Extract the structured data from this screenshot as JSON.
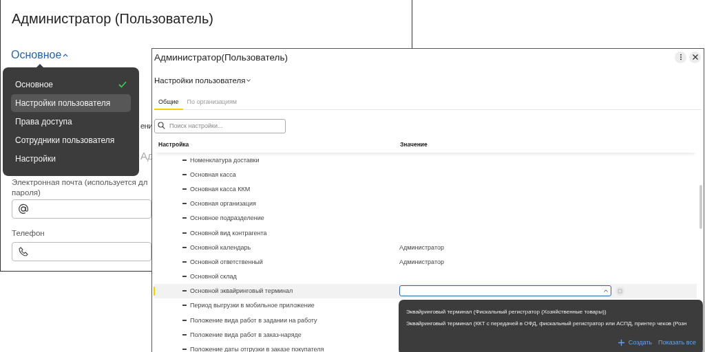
{
  "back_window": {
    "title": "Администратор (Пользователь)",
    "section_toggle": {
      "label": "Основное",
      "expanded": true
    },
    "section_menu": [
      {
        "label": "Основное",
        "selected": true,
        "hovered": false
      },
      {
        "label": "Настройки пользователя",
        "selected": false,
        "hovered": true
      },
      {
        "label": "Права доступа",
        "selected": false,
        "hovered": false
      },
      {
        "label": "Сотрудники пользователя",
        "selected": false,
        "hovered": false
      },
      {
        "label": "Настройки",
        "selected": false,
        "hovered": false
      }
    ],
    "obscured_texts": [
      "ени",
      "Ад"
    ],
    "fields": [
      {
        "kind": "email",
        "label": "Электронная почта (используется дл\nпароля)"
      },
      {
        "kind": "phone",
        "label": "Телефон"
      }
    ]
  },
  "front_window": {
    "title": "Администратор(Пользователь)",
    "section_label": "Настройки пользователя",
    "tabs": [
      {
        "label": "Общие",
        "selected": true
      },
      {
        "label": "По организациям",
        "selected": false
      }
    ],
    "search": {
      "placeholder": "Поиск настройки..."
    },
    "table": {
      "columns": [
        "Настройка",
        "Значение"
      ],
      "rows": [
        {
          "name": "Номенклатура доставки",
          "value": "",
          "selected": false
        },
        {
          "name": "Основная касса",
          "value": "",
          "selected": false
        },
        {
          "name": "Основная касса ККМ",
          "value": "",
          "selected": false
        },
        {
          "name": "Основная организация",
          "value": "",
          "selected": false
        },
        {
          "name": "Основное подразделение",
          "value": "",
          "selected": false
        },
        {
          "name": "Основной вид контрагента",
          "value": "",
          "selected": false
        },
        {
          "name": "Основной календарь",
          "value": "Администратор",
          "selected": false
        },
        {
          "name": "Основной ответственный",
          "value": "Администратор",
          "selected": false
        },
        {
          "name": "Основной склад",
          "value": "",
          "selected": false
        },
        {
          "name": "Основной эквайринговый терминал",
          "value": "",
          "selected": true
        },
        {
          "name": "Период выгрузки в мобильное приложение",
          "value": "",
          "selected": false
        },
        {
          "name": "Положение вида работ в задании на работу",
          "value": "",
          "selected": false
        },
        {
          "name": "Положение вида работ в заказ-наряде",
          "value": "",
          "selected": false
        },
        {
          "name": "Положение даты отгрузки в заказе покупателя",
          "value": "",
          "selected": false
        }
      ]
    },
    "choice_popup": {
      "options": [
        "Эквайринговый терминал  (Фискальный регистратор (Хозяйственные товары))",
        "Эквайринговый терминал  (ККТ с передачей в ОФД, фискальный регистратор или АСПД, принтер чеков (Розн"
      ],
      "create": "Создать",
      "show_all": "Показать все"
    }
  }
}
